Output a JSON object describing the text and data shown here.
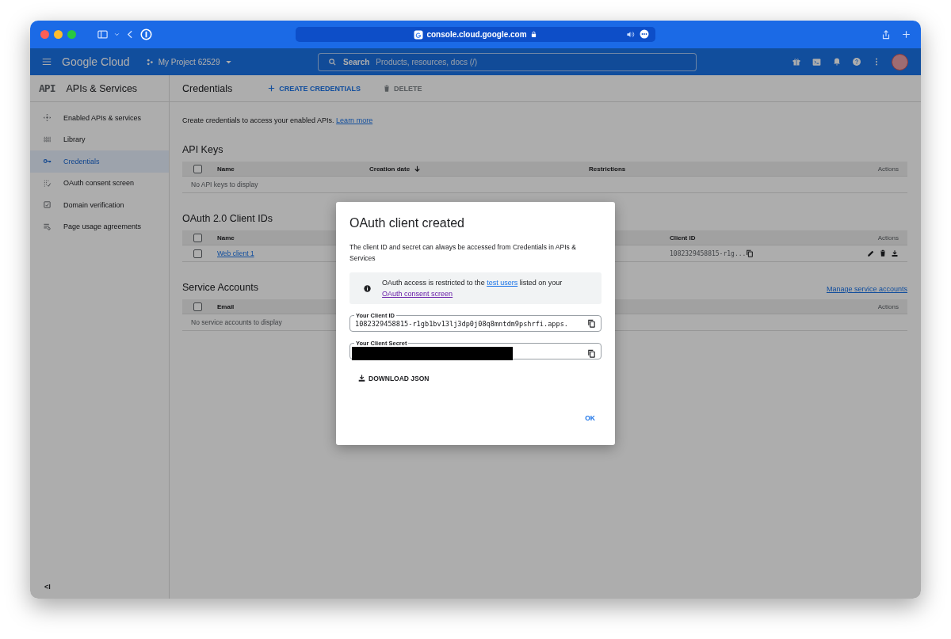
{
  "browser": {
    "address": "console.cloud.google.com"
  },
  "header": {
    "logo": "Google Cloud",
    "project": "My Project 62529",
    "search": {
      "label": "Search",
      "placeholder": "Products, resources, docs (/)"
    }
  },
  "sidebar": {
    "title_badge": "API",
    "title": "APIs & Services",
    "items": [
      {
        "label": "Enabled APIs & services",
        "selected": false
      },
      {
        "label": "Library",
        "selected": false
      },
      {
        "label": "Credentials",
        "selected": true
      },
      {
        "label": "OAuth consent screen",
        "selected": false
      },
      {
        "label": "Domain verification",
        "selected": false
      },
      {
        "label": "Page usage agreements",
        "selected": false
      }
    ],
    "collapse": "<I"
  },
  "toolbar": {
    "title": "Credentials",
    "create": "CREATE CREDENTIALS",
    "delete": "DELETE"
  },
  "intro": {
    "text": "Create credentials to access your enabled APIs. ",
    "link": "Learn more"
  },
  "sections": [
    {
      "kind": "api_keys",
      "title": "API Keys",
      "header_checked": false,
      "columns": [
        {
          "label": "Name",
          "sorted": false
        },
        {
          "label": "Creation date",
          "sorted": true
        },
        {
          "label": "Restrictions",
          "sorted": false
        },
        {
          "label": "Actions",
          "sorted": false
        }
      ],
      "empty_message": "No API keys to display"
    },
    {
      "kind": "oauth",
      "title": "OAuth 2.0 Client IDs",
      "header_checked": false,
      "columns": [
        {
          "label": "Name",
          "sorted": false
        },
        {
          "label": "Client ID",
          "sorted": false
        },
        {
          "label": "Actions",
          "sorted": false
        }
      ],
      "rows": [
        {
          "checked": false,
          "name": "Web client 1",
          "client_id": "1082329458815-r1g..."
        }
      ]
    },
    {
      "kind": "service",
      "title": "Service Accounts",
      "link": "Manage service accounts",
      "header_checked": false,
      "columns": [
        {
          "label": "Email",
          "sorted": false
        },
        {
          "label": "Actions",
          "sorted": false
        }
      ],
      "empty_message": "No service accounts to display"
    }
  ],
  "dialog": {
    "title": "OAuth client created",
    "text": "The client ID and secret can always be accessed from Credentials in APIs & Services",
    "notice": [
      {
        "text": "OAuth access is restricted to the "
      },
      {
        "link": "test users",
        "visited": false
      },
      {
        "text": " listed on your "
      },
      {
        "link": "OAuth consent screen",
        "visited": true
      }
    ],
    "fields": [
      {
        "label": "Your Client ID",
        "value": "1082329458815-r1gb1bv13lj3dp0j08q8mntdm9pshrfi.apps.",
        "redacted": false
      },
      {
        "label": "Your Client Secret",
        "redacted": true
      }
    ],
    "download": "DOWNLOAD JSON",
    "ok": "OK"
  }
}
